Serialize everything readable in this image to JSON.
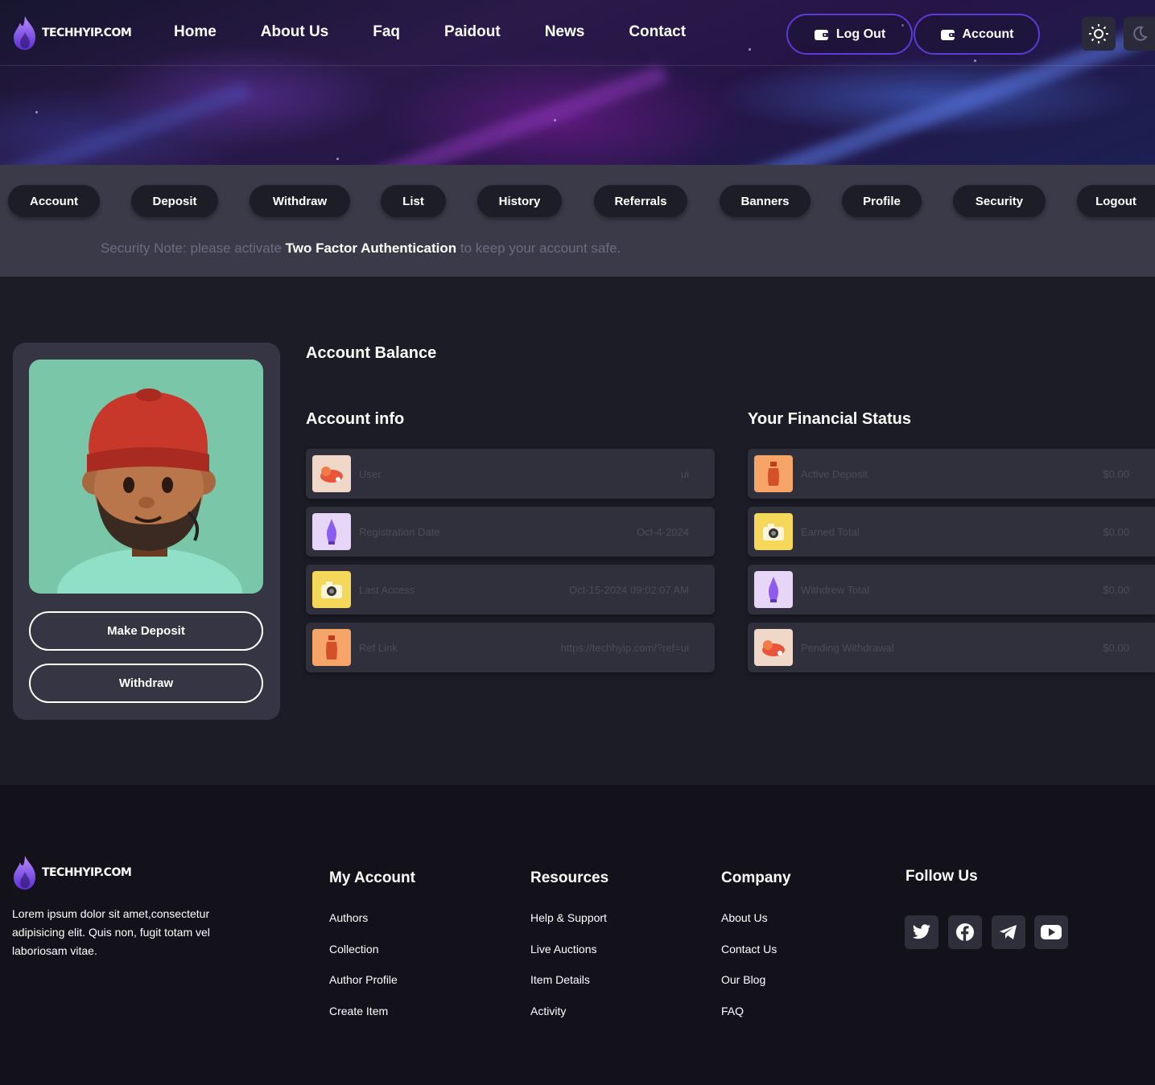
{
  "brand": {
    "name": "TECHHYIP.COM"
  },
  "nav": {
    "items": [
      "Home",
      "About Us",
      "Faq",
      "Paidout",
      "News",
      "Contact"
    ]
  },
  "header_buttons": {
    "logout": "Log Out",
    "account": "Account"
  },
  "tabs": [
    "Account",
    "Deposit",
    "Withdraw",
    "List",
    "History",
    "Referrals",
    "Banners",
    "Profile",
    "Security",
    "Logout"
  ],
  "security_note": {
    "prefix": "Security Note: please  activate",
    "highlight": "Two Factor Authentication",
    "suffix": "to keep your account safe."
  },
  "profile": {
    "deposit_button": "Make Deposit",
    "withdraw_button": "Withdraw"
  },
  "main": {
    "balance_title": "Account Balance",
    "account_info_title": "Account info",
    "financial_title": "Your Financial Status",
    "account_info": [
      {
        "label": "User",
        "value": "ui",
        "icon": "dog-thumb-icon"
      },
      {
        "label": "Registration Date",
        "value": "Oct-4-2024",
        "icon": "bottle-thumb-icon"
      },
      {
        "label": "Last Access",
        "value": "Oct-15-2024 09:02:07 AM",
        "icon": "camera-thumb-icon"
      },
      {
        "label": "Ref Link",
        "value": "https://techhyip.com/?ref=ui",
        "icon": "jar-thumb-icon"
      }
    ],
    "financial": [
      {
        "label": "Active Deposit",
        "value": "$0.00",
        "icon": "jar-thumb-icon"
      },
      {
        "label": "Earned Total",
        "value": "$0.00",
        "icon": "camera-thumb-icon"
      },
      {
        "label": "Withdrew Total",
        "value": "$0.00",
        "icon": "bottle-thumb-icon"
      },
      {
        "label": "Pending Withdrawal",
        "value": "$0.00",
        "icon": "dog-thumb-icon"
      }
    ]
  },
  "footer": {
    "brand": "TECHHYIP.COM",
    "about_lines": [
      "Lorem ipsum dolor sit amet,consectetur",
      "adipisicing elit. Quis non, fugit totam vel",
      "laboriosam vitae."
    ],
    "cols": [
      {
        "title": "My Account",
        "links": [
          "Authors",
          "Collection",
          "Author Profile",
          "Create Item"
        ]
      },
      {
        "title": "Resources",
        "links": [
          "Help & Support",
          "Live Auctions",
          "Item Details",
          "Activity"
        ]
      },
      {
        "title": "Company",
        "links": [
          "About Us",
          "Contact Us",
          "Our Blog",
          "FAQ"
        ]
      }
    ],
    "follow_title": "Follow Us",
    "social": [
      "twitter-icon",
      "facebook-icon",
      "telegram-icon",
      "youtube-icon"
    ]
  },
  "colors": {
    "accent": "#5b3bd8",
    "card": "#353543",
    "row": "#30303d",
    "page": "#1c1c26",
    "footer": "#13121b"
  }
}
